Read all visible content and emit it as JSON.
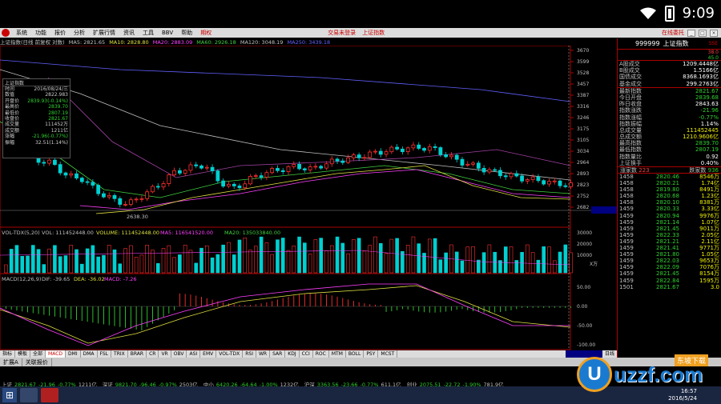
{
  "status_bar": {
    "time": "9:09"
  },
  "menubar": {
    "items": [
      "系统",
      "功能",
      "报价",
      "分析",
      "扩展行情",
      "资讯",
      "工具",
      "BBV",
      "帮助",
      "期权"
    ],
    "center": [
      "交易未登录",
      "上证指数"
    ],
    "right_label": "在线委托"
  },
  "indicator_header": {
    "title": "上证指数(日线 前复权 对数)",
    "ma5": "MA5: 2821.65",
    "ma10": "MA10: 2828.80",
    "ma20": "MA20: 2883.09",
    "ma60": "MA60: 2926.18",
    "ma120": "MA120: 3048.19",
    "ma250": "MA250: 3439.18"
  },
  "tooltip": {
    "title": "上证指数",
    "rows": [
      {
        "label": "时间",
        "value": "2016/08/24/三",
        "color": ""
      },
      {
        "label": "数值",
        "value": "2822.983",
        "color": ""
      },
      {
        "label": "开盘价",
        "value": "2839.93(-0.14%)",
        "color": "green"
      },
      {
        "label": "最高价",
        "value": "2839.70",
        "color": "green"
      },
      {
        "label": "最低价",
        "value": "2807.19",
        "color": "green"
      },
      {
        "label": "收盘价",
        "value": "2821.67",
        "color": "green"
      },
      {
        "label": "成交量",
        "value": "111452万",
        "color": ""
      },
      {
        "label": "成交额",
        "value": "1211亿",
        "color": ""
      },
      {
        "label": "涨幅",
        "value": "-21.96(-0.77%)",
        "color": "green"
      },
      {
        "label": "振幅",
        "value": "32.51(1.14%)",
        "color": ""
      }
    ]
  },
  "chart_data": {
    "type": "candlestick",
    "price_axis": [
      "3670",
      "3599",
      "3528",
      "3457",
      "3387",
      "3316",
      "3246",
      "3175",
      "3105",
      "3034",
      "2964",
      "2893",
      "2823",
      "2752",
      "2682"
    ],
    "low_label": "2638.30",
    "high_label": "3358).60",
    "volume_header": {
      "title": "VOL-TDX(5,20)",
      "vol": "VOL: 111452448.00",
      "volume": "VOLUME: 111452448.00",
      "ma5": "MA5: 116541520.00",
      "ma20": "MA20: 135033840.00"
    },
    "volume_axis": [
      "30000",
      "20000",
      "10000"
    ],
    "volume_unit": "X万",
    "macd_header": {
      "title": "MACD(12,26,9)",
      "dif": "DIF: -39.65",
      "dea": "DEA: -36.02",
      "macd": "MACD: -7.26"
    },
    "macd_axis": [
      "50.00",
      "0.00",
      "-50.00",
      "-100.00"
    ],
    "x_labels": [
      "2016/6",
      "2",
      "3",
      "4",
      "5",
      "6"
    ]
  },
  "right_panel": {
    "code": "999999",
    "name": "上证指数",
    "tag": "SSE",
    "ratio_up": "38.0",
    "ratio_down": "45.0",
    "rows1": [
      {
        "k": "A股成交",
        "v": "1209.4448亿",
        "c": "white"
      },
      {
        "k": "B股成交",
        "v": "1.5166亿",
        "c": "white"
      },
      {
        "k": "国债成交",
        "v": "8368.1693亿",
        "c": "white"
      },
      {
        "k": "基金成交",
        "v": "299.2763亿",
        "c": "white"
      }
    ],
    "rows2": [
      {
        "k": "最新指数",
        "v": "2821.67",
        "c": "green"
      },
      {
        "k": "今日开盘",
        "v": "2839.68",
        "c": "green"
      },
      {
        "k": "昨日收盘",
        "v": "2843.63",
        "c": "white"
      },
      {
        "k": "指数涨跌",
        "v": "-21.96",
        "c": "green"
      },
      {
        "k": "指数涨幅",
        "v": "-0.77%",
        "c": "green"
      },
      {
        "k": "指数振幅",
        "v": "1.14%",
        "c": "white"
      },
      {
        "k": "总成交量",
        "v": "111452445",
        "c": "yellow"
      },
      {
        "k": "总成交额",
        "v": "1210.9606亿",
        "c": "yellow"
      },
      {
        "k": "最高指数",
        "v": "2839.70",
        "c": "green"
      },
      {
        "k": "最低指数",
        "v": "2807.19",
        "c": "green"
      },
      {
        "k": "指数量比",
        "v": "0.92",
        "c": "white"
      },
      {
        "k": "上证换手",
        "v": "0.40%",
        "c": "white"
      }
    ],
    "updown": {
      "up_label": "涨家数",
      "up": "223",
      "down_label": "跌家数",
      "down": "936"
    },
    "ticks": [
      {
        "t": "1458",
        "p": "2820.46",
        "q": "8546万",
        "c": "green"
      },
      {
        "t": "1458",
        "p": "2820.21",
        "q": "1.74亿",
        "c": "green"
      },
      {
        "t": "1458",
        "p": "2819.80",
        "q": "8491万",
        "c": "green"
      },
      {
        "t": "1458",
        "p": "2820.68",
        "q": "1.23亿",
        "c": "green"
      },
      {
        "t": "1458",
        "p": "2820.10",
        "q": "8381万",
        "c": "green"
      },
      {
        "t": "1459",
        "p": "2820.33",
        "q": "3.33亿",
        "c": "green"
      },
      {
        "t": "1459",
        "p": "2820.94",
        "q": "9976万",
        "c": "green"
      },
      {
        "t": "1459",
        "p": "2821.14",
        "q": "1.07亿",
        "c": "green"
      },
      {
        "t": "1459",
        "p": "2821.45",
        "q": "9011万",
        "c": "green"
      },
      {
        "t": "1459",
        "p": "2822.33",
        "q": "2.05亿",
        "c": "green"
      },
      {
        "t": "1459",
        "p": "2821.21",
        "q": "2.11亿",
        "c": "green"
      },
      {
        "t": "1459",
        "p": "2821.41",
        "q": "9771万",
        "c": "green"
      },
      {
        "t": "1459",
        "p": "2821.80",
        "q": "1.05亿",
        "c": "green"
      },
      {
        "t": "1459",
        "p": "2822.03",
        "q": "9653万",
        "c": "green"
      },
      {
        "t": "1459",
        "p": "2822.09",
        "q": "7076万",
        "c": "green"
      },
      {
        "t": "1459",
        "p": "2821.45",
        "q": "8154万",
        "c": "green"
      },
      {
        "t": "1459",
        "p": "2822.84",
        "q": "1595万",
        "c": "green"
      },
      {
        "t": "1501",
        "p": "2821.67",
        "q": "3.0",
        "c": "green"
      }
    ]
  },
  "bottom_tabs": [
    "指标",
    "模板",
    "全部",
    "MACD",
    "DMI",
    "DMA",
    "FSL",
    "TRIX",
    "BRAR",
    "CR",
    "VR",
    "OBV",
    "ASI",
    "EMV",
    "VOL-TDX",
    "RSI",
    "WR",
    "SAR",
    "KDJ",
    "CCI",
    "ROC",
    "MTM",
    "BOLL",
    "PSY",
    "MCST"
  ],
  "bottom_right_tab": "日线",
  "sub_tabs": [
    "扩展A",
    "关联报价"
  ],
  "ticker": [
    {
      "name": "上证",
      "val": "2821.67",
      "chg": "-21.96",
      "pct": "-0.77%",
      "amt": "1211亿",
      "c": "green"
    },
    {
      "name": "深证",
      "val": "9821.70",
      "chg": "-96.46",
      "pct": "-0.97%",
      "amt": "2503亿",
      "c": "green"
    },
    {
      "name": "中小",
      "val": "6420.26",
      "chg": "-64.64",
      "pct": "-1.00%",
      "amt": "1232亿",
      "c": "green"
    },
    {
      "name": "沪深",
      "val": "3363.56",
      "chg": "-23.66",
      "pct": "-0.77%",
      "amt": "611.1亿",
      "c": "green"
    },
    {
      "name": "创业",
      "val": "2075.51",
      "chg": "-22.72",
      "pct": "-1.90%",
      "amt": "781.9亿",
      "c": "green"
    }
  ],
  "taskbar": {
    "time": "16:57",
    "date": "2016/5/24"
  },
  "watermark": {
    "text": "uzzf.com",
    "badge": "东坡下载"
  }
}
